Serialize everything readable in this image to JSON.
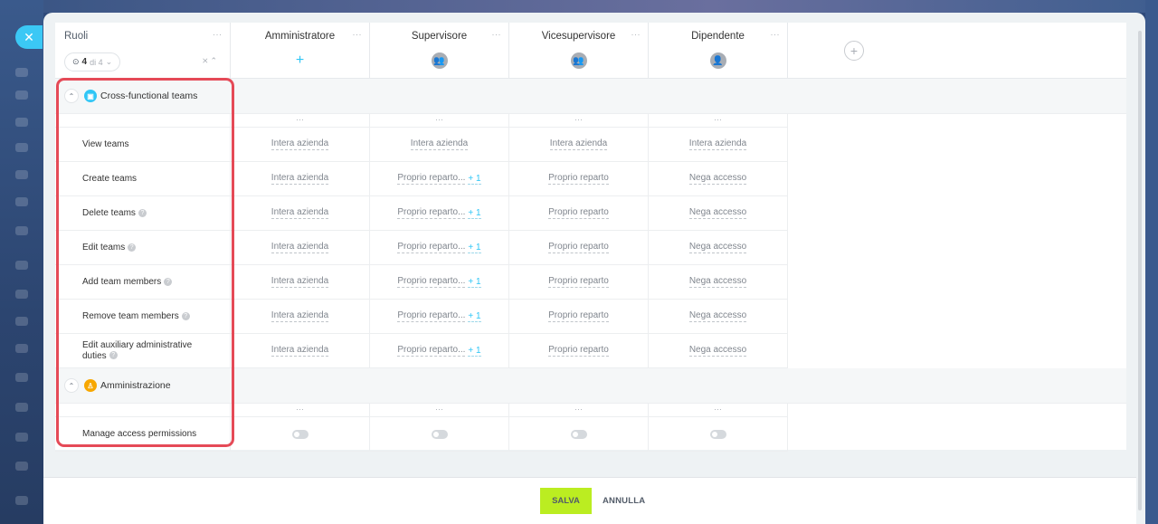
{
  "roles_header": {
    "title": "Ruoli",
    "filter_count": "4",
    "filter_total": "di 4"
  },
  "roles": [
    {
      "name": "Amministratore",
      "icon": "plus-icon"
    },
    {
      "name": "Supervisore",
      "icon": "group-icon"
    },
    {
      "name": "Vicesupervisore",
      "icon": "group-icon"
    },
    {
      "name": "Dipendente",
      "icon": "user-icon"
    }
  ],
  "sections": [
    {
      "title": "Cross-functional teams",
      "icon_color": "#2fc6f6",
      "rows": [
        {
          "label": "View teams",
          "values": [
            "Intera azienda",
            "Intera azienda",
            "Intera azienda",
            "Intera azienda"
          ],
          "extra": [
            "",
            "",
            "",
            ""
          ]
        },
        {
          "label": "Create teams",
          "values": [
            "Intera azienda",
            "Proprio reparto...",
            "Proprio reparto",
            "Nega accesso"
          ],
          "extra": [
            "",
            "+ 1",
            "",
            ""
          ]
        },
        {
          "label": "Delete teams",
          "values": [
            "Intera azienda",
            "Proprio reparto...",
            "Proprio reparto",
            "Nega accesso"
          ],
          "extra": [
            "",
            "+ 1",
            "",
            ""
          ]
        },
        {
          "label": "Edit teams",
          "values": [
            "Intera azienda",
            "Proprio reparto...",
            "Proprio reparto",
            "Nega accesso"
          ],
          "extra": [
            "",
            "+ 1",
            "",
            ""
          ]
        },
        {
          "label": "Add team members",
          "values": [
            "Intera azienda",
            "Proprio reparto...",
            "Proprio reparto",
            "Nega accesso"
          ],
          "extra": [
            "",
            "+ 1",
            "",
            ""
          ]
        },
        {
          "label": "Remove team members",
          "values": [
            "Intera azienda",
            "Proprio reparto...",
            "Proprio reparto",
            "Nega accesso"
          ],
          "extra": [
            "",
            "+ 1",
            "",
            ""
          ]
        },
        {
          "label": "Edit auxiliary administrative duties",
          "values": [
            "Intera azienda",
            "Proprio reparto...",
            "Proprio reparto",
            "Nega accesso"
          ],
          "extra": [
            "",
            "+ 1",
            "",
            ""
          ]
        }
      ]
    },
    {
      "title": "Amministrazione",
      "icon_color": "#f7a700",
      "rows": [
        {
          "label": "Manage access permissions",
          "toggle": true
        }
      ]
    }
  ],
  "footer": {
    "save_label": "SALVA",
    "cancel_label": "ANNULLA"
  },
  "colors": {
    "accent": "#2fc6f6",
    "save": "#bbed21",
    "highlight": "#e54a57"
  }
}
